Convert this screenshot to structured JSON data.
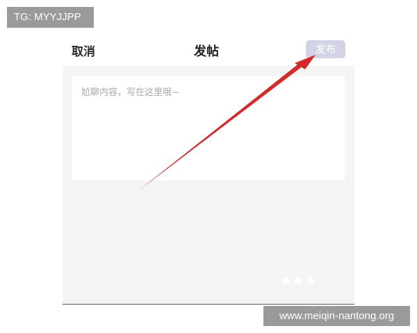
{
  "overlay": {
    "tg_badge": "TG: MYYJJPP",
    "watermark": "www.meiqin-nantong.org"
  },
  "header": {
    "cancel_label": "取消",
    "title": "发帖",
    "publish_label": "发布"
  },
  "composer": {
    "value": "",
    "placeholder": "尬聊内容，写在这里哦~"
  },
  "colors": {
    "publish_button": "#d3d3e6",
    "panel_background": "#f5f5f5",
    "arrow": "#d42a2a"
  },
  "icons": {
    "annotation": "red-arrow-pointing-to-publish"
  }
}
